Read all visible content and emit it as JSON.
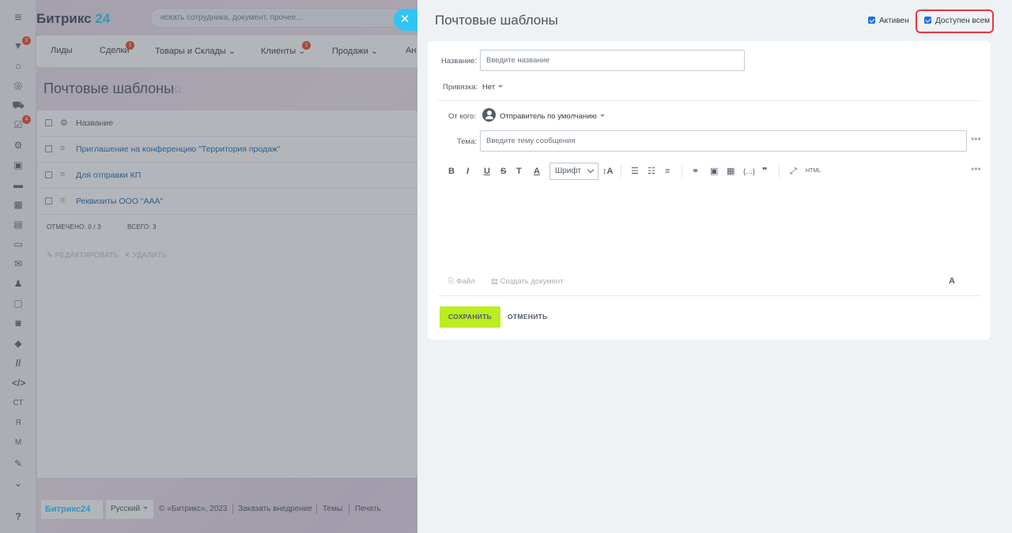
{
  "app": {
    "logo_name": "Битрикс",
    "logo_num": "24",
    "search_placeholder": "искать сотрудника, документ, прочее...",
    "menu_icon": "hamburger-icon"
  },
  "sidebar": {
    "badges": {
      "filter": "3",
      "tasks": "4"
    },
    "text_items": [
      "СТ",
      "Я",
      "М"
    ],
    "help_icon": "?"
  },
  "topnav": {
    "items": [
      "Лиды",
      "Сделки",
      "Товары и Склады",
      "Клиенты",
      "Продажи",
      "Ан"
    ],
    "badges": {
      "deals": "1",
      "clients": "1"
    }
  },
  "list_page": {
    "title": "Почтовые шаблоны",
    "column_name": "Название",
    "rows": [
      "Приглашение на конференцию \"Территория продаж\"",
      "Для отправки КП",
      "Реквизиты ООО \"ААА\""
    ],
    "selected": "ОТМЕЧЕНО: 0 / 3",
    "total": "ВСЕГО: 3",
    "edit_action": "РЕДАКТИРОВАТЬ",
    "delete_action": "УДАЛИТЬ"
  },
  "footer": {
    "logo": "Битрикс24",
    "language": "Русский",
    "copyright": "© «Битрикс», 2023",
    "order": "Заказать внедрение",
    "themes": "Темы",
    "print": "Печать"
  },
  "panel": {
    "title": "Почтовые шаблоны",
    "close_symbol": "✕",
    "active_label": "Активен",
    "active_checked": true,
    "shared_label": "Доступен всем",
    "shared_checked": true,
    "name_label": "Название:",
    "name_placeholder": "Введите название",
    "binding_label": "Привязка:",
    "binding_value": "Нет",
    "from_label": "От кого:",
    "from_value": "Отправитель по умолчанию",
    "subject_label": "Тема:",
    "subject_placeholder": "Введите тему сообщения",
    "toolbar": {
      "bold": "B",
      "italic": "I",
      "underline": "U",
      "strike": "S",
      "clear": "T",
      "color": "A",
      "font": "Шрифт",
      "font_size": "↕A",
      "html": "HTML"
    },
    "attach_file": "Файл",
    "create_doc": "Создать документ",
    "text_style": "A",
    "save": "СОХРАНИТЬ",
    "cancel": "ОТМЕНИТЬ"
  },
  "colors": {
    "accent_blue": "#2fc6f6",
    "save_green": "#bbed21",
    "highlight_red": "#e8363f",
    "checkbox_blue": "#1c6fe0"
  }
}
